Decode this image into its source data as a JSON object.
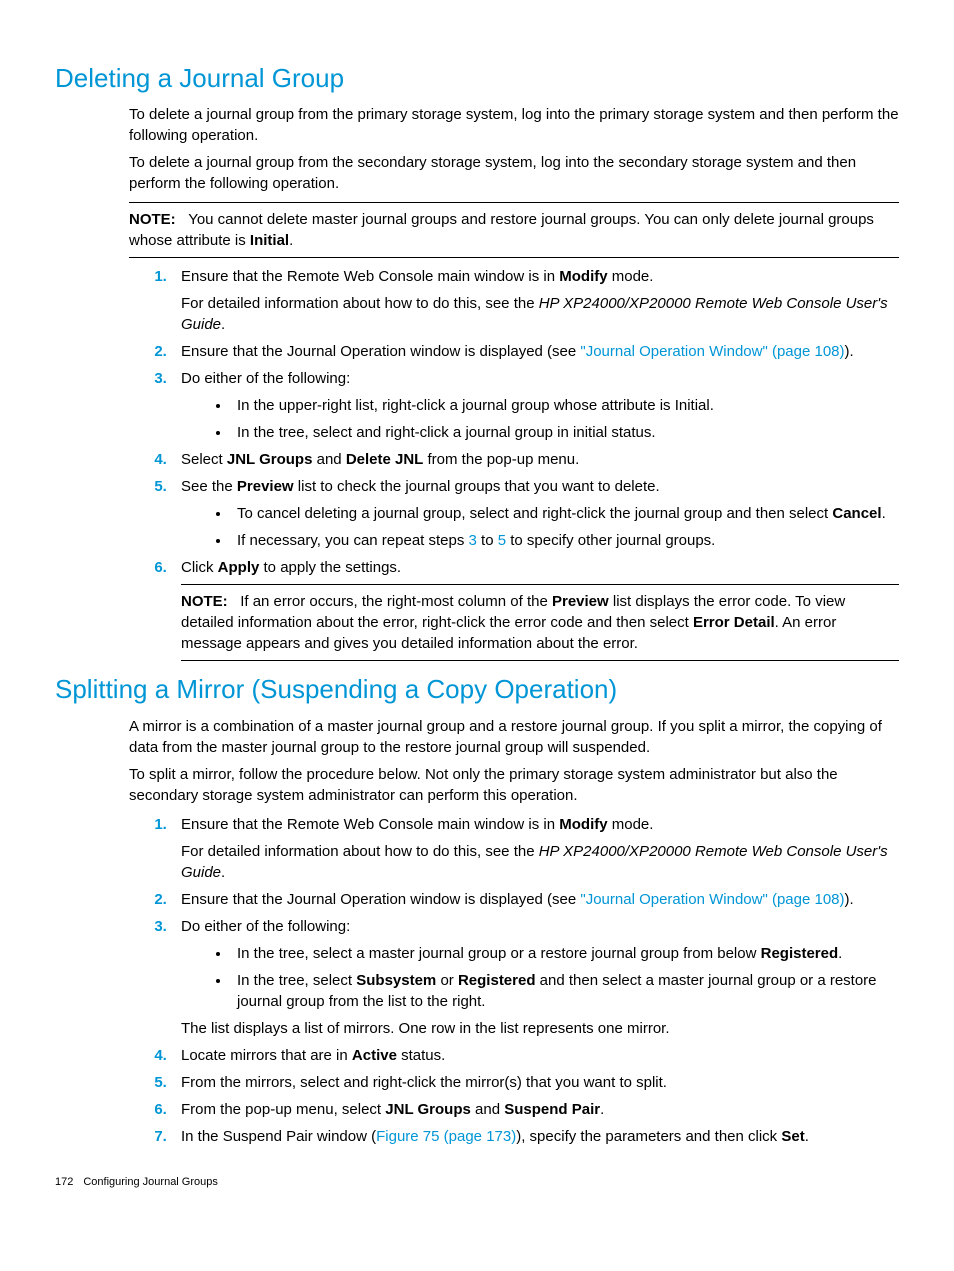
{
  "section1": {
    "heading": "Deleting a Journal Group",
    "p1": "To delete a journal group from the primary storage system, log into the primary storage system and then perform the following operation.",
    "p2": "To delete a journal group from the secondary storage system, log into the secondary storage system and then perform the following operation.",
    "note1_label": "NOTE:",
    "note1_t1": "You cannot delete master journal groups and restore journal groups. You can only delete journal groups whose attribute is ",
    "note1_b1": "Initial",
    "note1_t2": ".",
    "s1_a": "Ensure that the Remote Web Console main window is in ",
    "s1_b": "Modify",
    "s1_c": " mode.",
    "s1_d": "For detailed information about how to do this, see the ",
    "s1_e": "HP XP24000/XP20000 Remote Web Console User's Guide",
    "s1_f": ".",
    "s2_a": "Ensure that the Journal Operation window is displayed (see ",
    "s2_link": "\"Journal Operation Window\" (page 108)",
    "s2_b": ").",
    "s3": "Do either of the following:",
    "s3_b1": "In the upper-right list, right-click a journal group whose attribute is Initial.",
    "s3_b2": "In the tree, select and right-click a journal group in initial status.",
    "s4_a": "Select ",
    "s4_b": "JNL Groups",
    "s4_c": " and ",
    "s4_d": "Delete JNL",
    "s4_e": " from the pop-up menu.",
    "s5_a": "See the ",
    "s5_b": "Preview",
    "s5_c": " list to check the journal groups that you want to delete.",
    "s5_b1a": "To cancel deleting a journal group, select and right-click the journal group and then select ",
    "s5_b1b": "Cancel",
    "s5_b1c": ".",
    "s5_b2a": "If necessary, you can repeat steps ",
    "s5_b2link1": "3",
    "s5_b2mid": " to ",
    "s5_b2link2": "5",
    "s5_b2b": " to specify other journal groups.",
    "s6_a": "Click ",
    "s6_b": "Apply",
    "s6_c": " to apply the settings.",
    "note2_label": "NOTE:",
    "note2_a": "If an error occurs, the right-most column of the ",
    "note2_b": "Preview",
    "note2_c": " list displays the error code. To view detailed information about the error, right-click the error code and then select ",
    "note2_d": "Error Detail",
    "note2_e": ". An error message appears and gives you detailed information about the error."
  },
  "section2": {
    "heading": "Splitting a Mirror (Suspending a Copy Operation)",
    "p1": "A mirror is a combination of a master journal group and a restore journal group. If you split a mirror, the copying of data from the master journal group to the restore journal group will suspended.",
    "p2": "To split a mirror, follow the procedure below. Not only the primary storage system administrator but also the secondary storage system administrator can perform this operation.",
    "s1_a": "Ensure that the Remote Web Console main window is in ",
    "s1_b": "Modify",
    "s1_c": " mode.",
    "s1_d": "For detailed information about how to do this, see the ",
    "s1_e": "HP XP24000/XP20000 Remote Web Console User's Guide",
    "s1_f": ".",
    "s2_a": "Ensure that the Journal Operation window is displayed (see ",
    "s2_link": "\"Journal Operation Window\" (page 108)",
    "s2_b": ").",
    "s3": "Do either of the following:",
    "s3_b1a": "In the tree, select a master journal group or a restore journal group from below ",
    "s3_b1b": "Registered",
    "s3_b1c": ".",
    "s3_b2a": "In the tree, select ",
    "s3_b2b": "Subsystem",
    "s3_b2c": " or ",
    "s3_b2d": "Registered",
    "s3_b2e": " and then select a master journal group or a restore journal group from the list to the right.",
    "s3_f": "The list displays a list of mirrors. One row in the list represents one mirror.",
    "s4_a": "Locate mirrors that are in ",
    "s4_b": "Active",
    "s4_c": " status.",
    "s5": "From the mirrors, select and right-click the mirror(s) that you want to split.",
    "s6_a": "From the pop-up menu, select ",
    "s6_b": "JNL Groups",
    "s6_c": " and ",
    "s6_d": "Suspend Pair",
    "s6_e": ".",
    "s7_a": "In the Suspend Pair window (",
    "s7_link": "Figure 75 (page 173)",
    "s7_b": "), specify the parameters and then click ",
    "s7_c": "Set",
    "s7_d": "."
  },
  "footer": {
    "page": "172",
    "title": "Configuring Journal Groups"
  }
}
